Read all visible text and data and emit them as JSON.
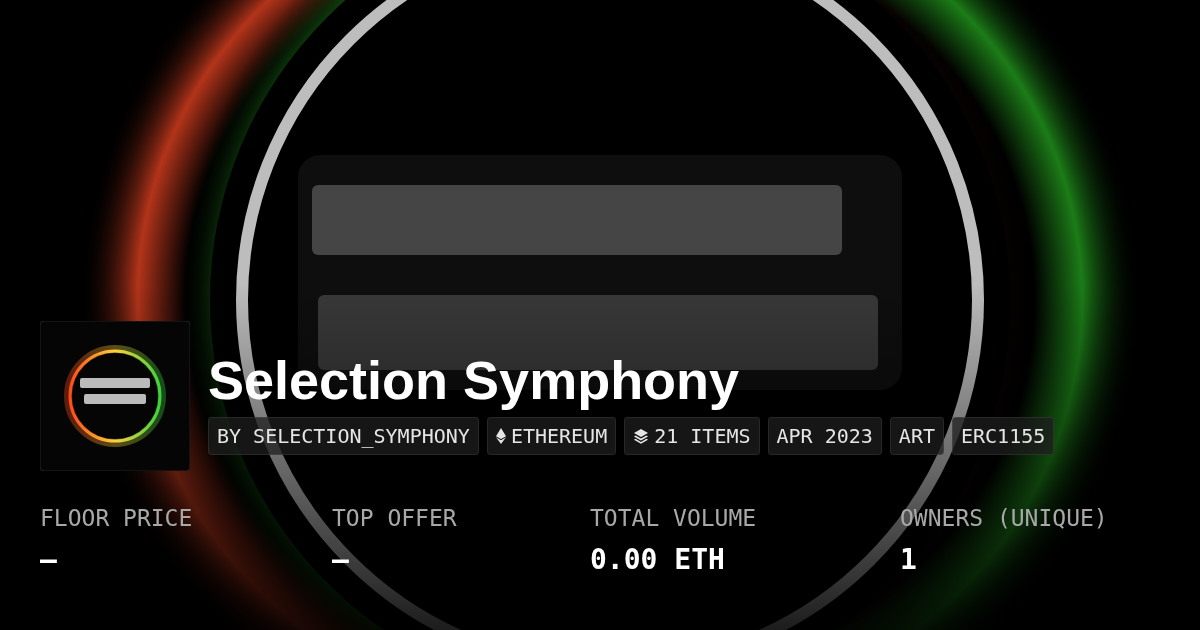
{
  "collection": {
    "title": "Selection Symphony",
    "tags": [
      {
        "kind": "creator",
        "label": "BY SELECTION_SYMPHONY"
      },
      {
        "kind": "chain",
        "label": "ETHEREUM"
      },
      {
        "kind": "items",
        "label": "21 ITEMS"
      },
      {
        "kind": "plain",
        "label": "APR 2023"
      },
      {
        "kind": "plain",
        "label": "ART"
      },
      {
        "kind": "plain",
        "label": "ERC1155"
      }
    ]
  },
  "stats": [
    {
      "label": "FLOOR PRICE",
      "value": "—"
    },
    {
      "label": "TOP OFFER",
      "value": "—"
    },
    {
      "label": "TOTAL VOLUME",
      "value": "0.00 ETH"
    },
    {
      "label": "OWNERS (UNIQUE)",
      "value": "1"
    }
  ]
}
